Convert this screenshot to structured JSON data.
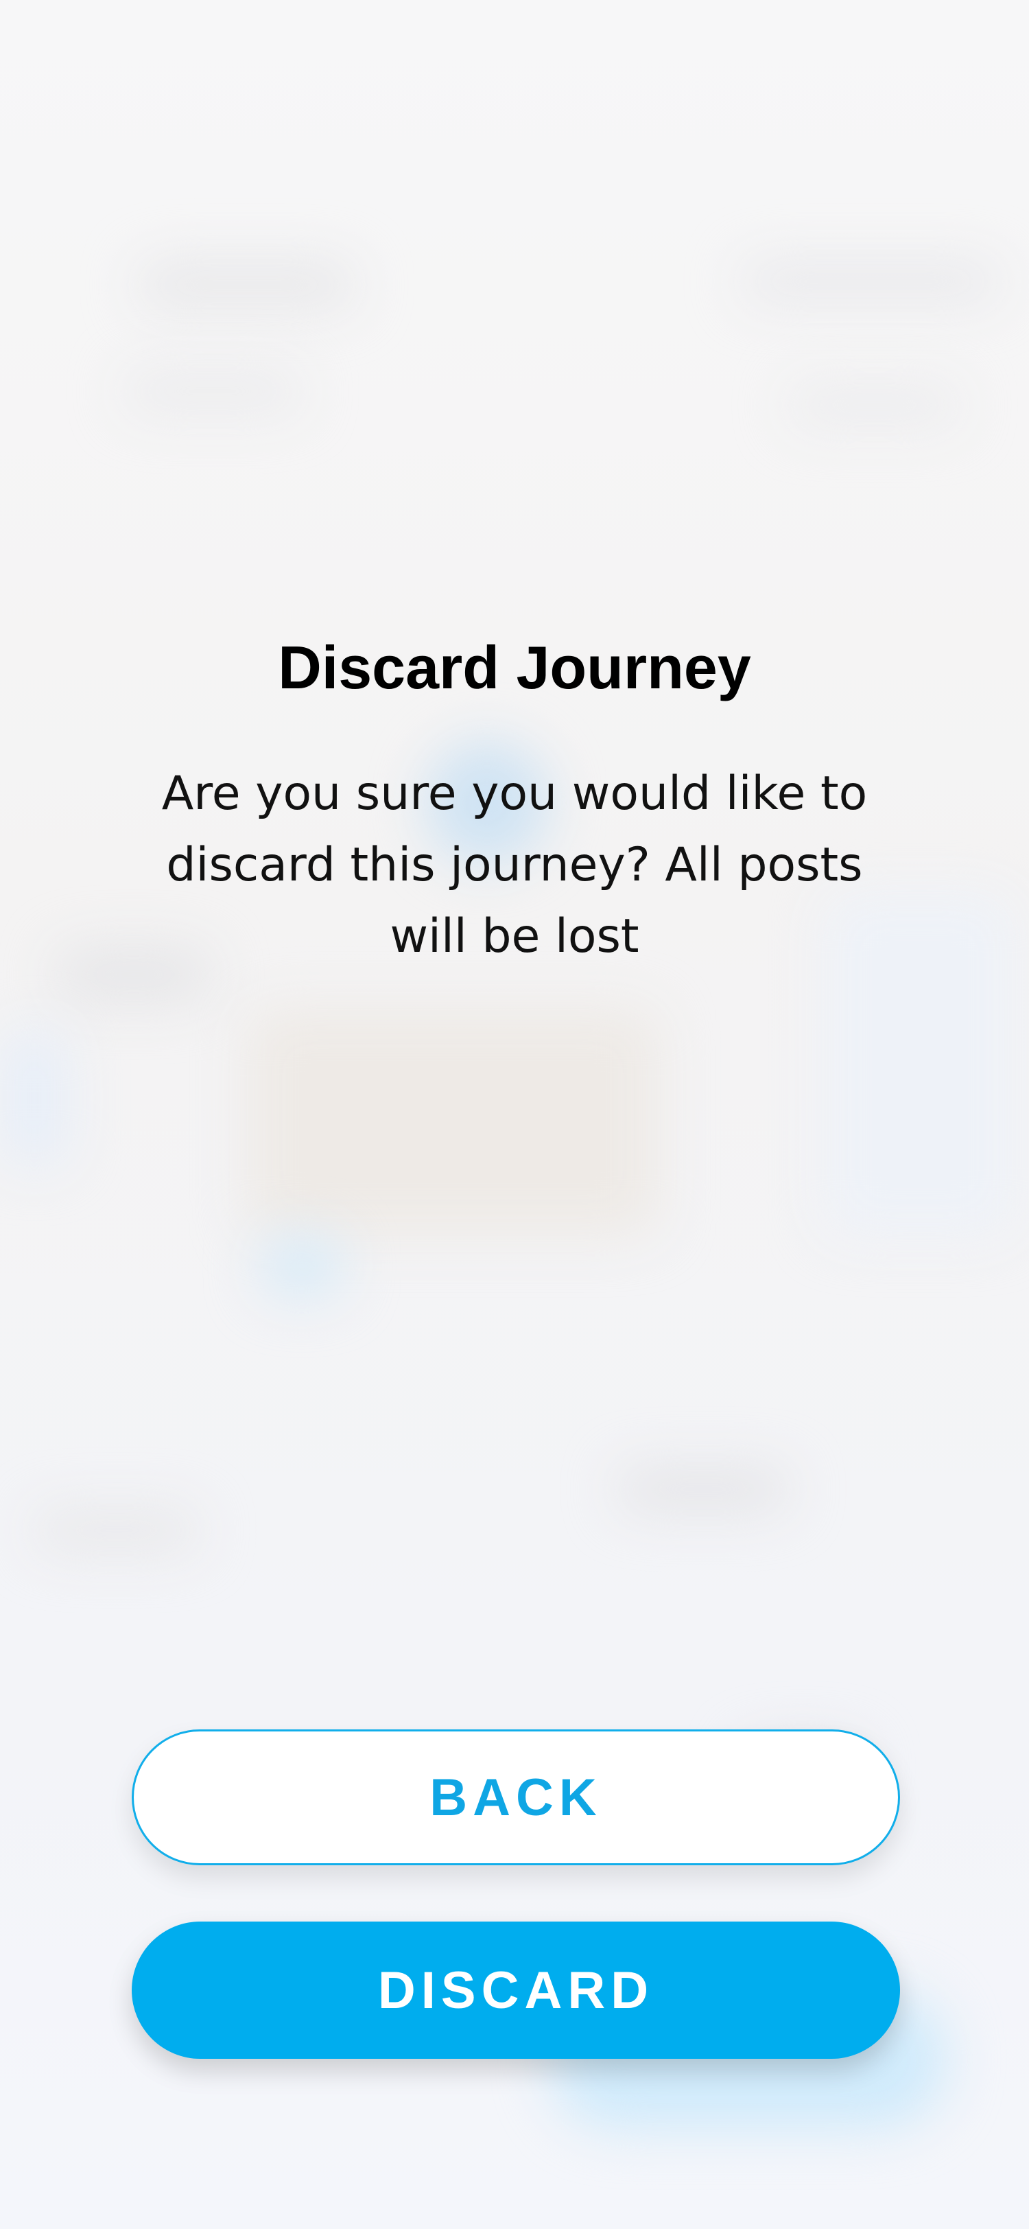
{
  "dialog": {
    "title": "Discard Journey",
    "message": "Are you sure you would like to discard this journey? All posts will be lost",
    "back_label": "BACK",
    "discard_label": "DISCARD"
  },
  "colors": {
    "accent": "#00adee",
    "back_text": "#0fa6e4",
    "title_text": "#000000",
    "background": "#f5f5f7"
  }
}
